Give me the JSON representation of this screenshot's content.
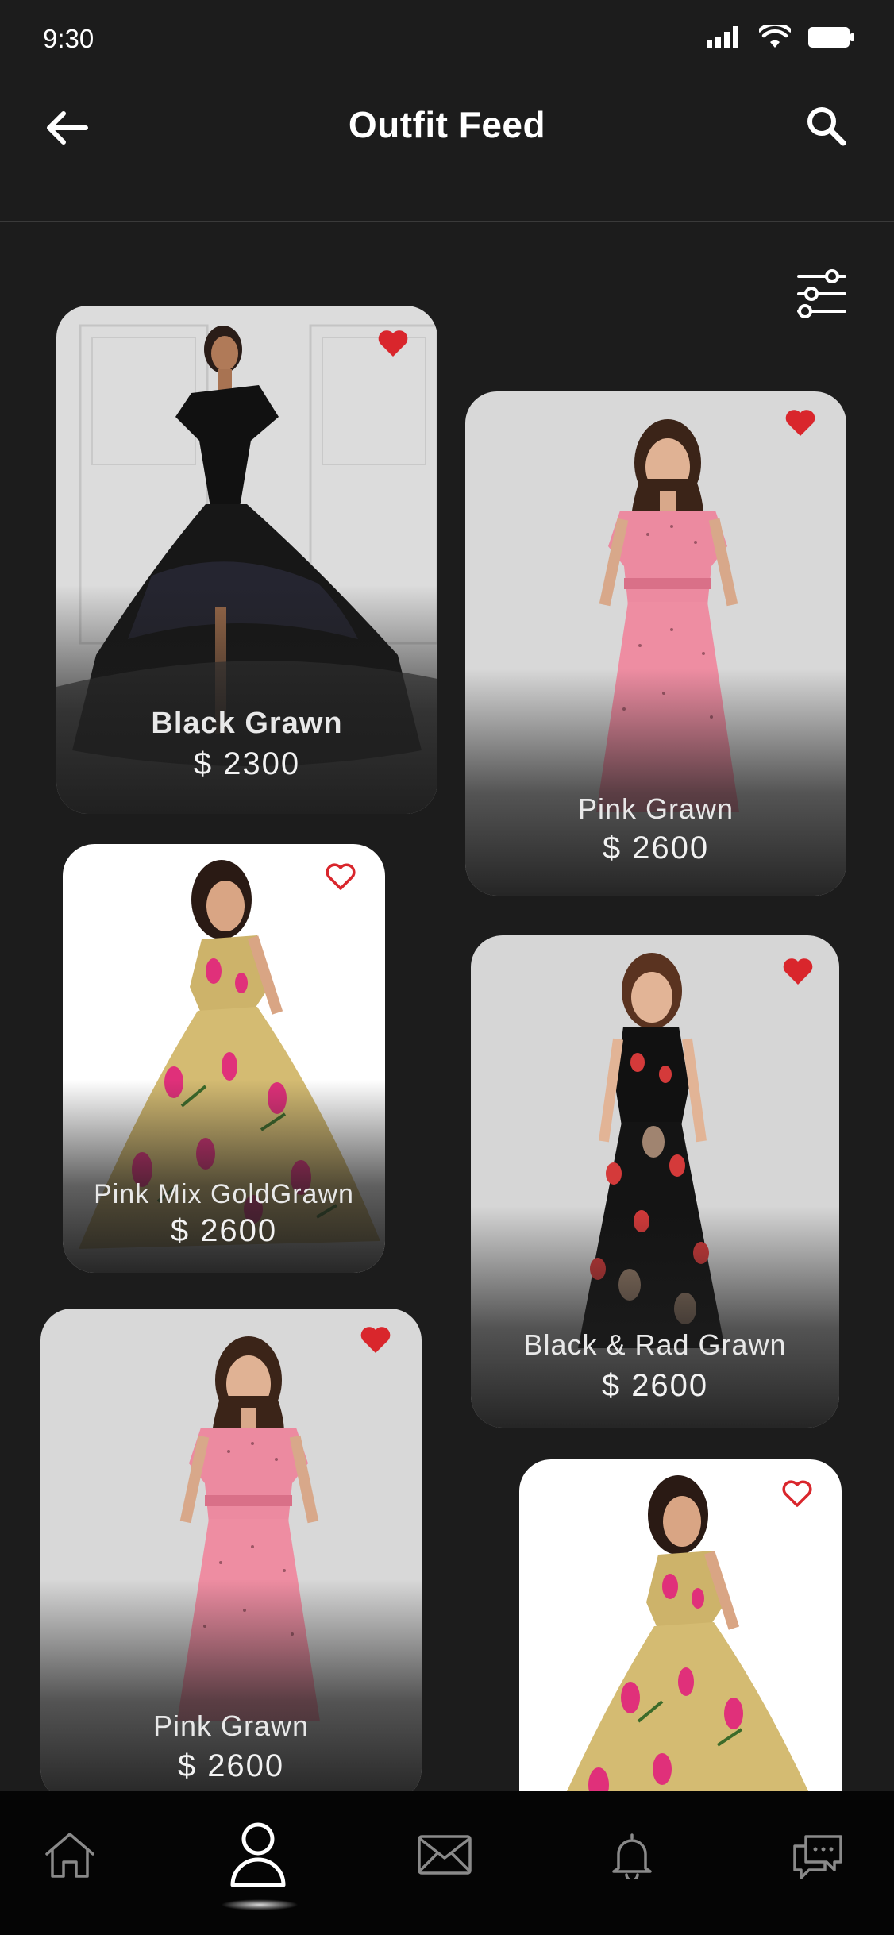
{
  "status_bar": {
    "time": "9:30"
  },
  "header": {
    "title": "Outfit Feed"
  },
  "products": [
    {
      "name": "Black Grawn",
      "price": "$ 2300",
      "favorite": true,
      "dress": "black-gown"
    },
    {
      "name": "Pink Grawn",
      "price": "$  2600",
      "favorite": true,
      "dress": "pink-dress"
    },
    {
      "name": "Pink Mix GoldGrawn",
      "price": "$  2600",
      "favorite": false,
      "dress": "floral-gold-gown"
    },
    {
      "name": "Black & Rad Grawn",
      "price": "$  2600",
      "favorite": true,
      "dress": "black-red-dress"
    },
    {
      "name": "Pink Grawn",
      "price": "$  2600",
      "favorite": true,
      "dress": "pink-dress"
    },
    {
      "name": "",
      "price": "",
      "favorite": false,
      "dress": "floral-gold-gown"
    }
  ],
  "bottom_nav": [
    "home-icon",
    "profile-icon",
    "mail-icon",
    "bell-icon",
    "chat-icon"
  ],
  "colors": {
    "background": "#1c1c1c",
    "nav_background": "#050505",
    "heart": "#d9262c",
    "text": "#ffffff"
  }
}
